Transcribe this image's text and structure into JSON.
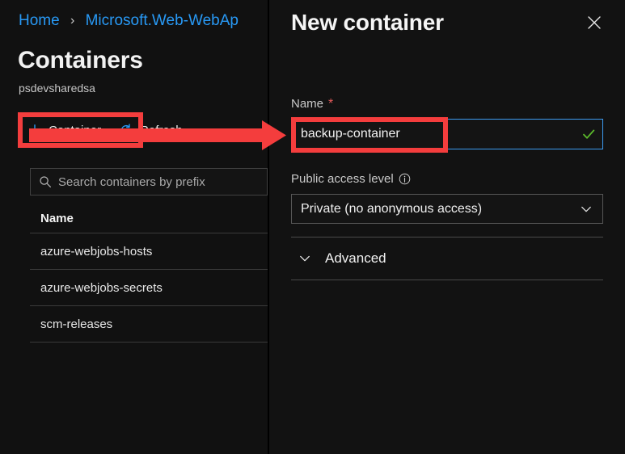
{
  "left_panel": {
    "breadcrumb": {
      "items": [
        {
          "label": "Home"
        },
        {
          "label": "Microsoft.Web-WebAp"
        }
      ],
      "separator": "›"
    },
    "page_title": "Containers",
    "page_subtitle": "psdevsharedsa",
    "toolbar": {
      "add_container_label": "Container",
      "add_container_icon": "plus-icon",
      "refresh_label": "Refresh",
      "refresh_icon": "refresh-icon"
    },
    "search": {
      "placeholder": "Search containers by prefix",
      "value": "",
      "icon": "search-icon"
    },
    "table": {
      "columns": [
        "Name"
      ],
      "rows": [
        {
          "name": "azure-webjobs-hosts"
        },
        {
          "name": "azure-webjobs-secrets"
        },
        {
          "name": "scm-releases"
        }
      ]
    }
  },
  "right_panel": {
    "title": "New container",
    "close_icon": "close-icon",
    "name_field": {
      "label": "Name",
      "required_marker": "*",
      "value": "backup-container",
      "valid_icon": "checkmark-icon"
    },
    "public_access": {
      "label": "Public access level",
      "info_icon": "info-icon",
      "selected": "Private (no anonymous access)",
      "chevron_icon": "chevron-down-icon"
    },
    "advanced": {
      "label": "Advanced",
      "chevron_icon": "chevron-down-icon",
      "expanded": false
    }
  },
  "annotations": {
    "highlight_container_button": "red-rectangle-highlight",
    "highlight_name_input": "red-rectangle-highlight",
    "arrow": "red-arrow-pointing-right"
  },
  "colors": {
    "background": "#0f0f0f",
    "panel": "#121212",
    "accent_link": "#2899f5",
    "annotation_red": "#f43d3d",
    "valid_green": "#5bb82b",
    "required_red": "#e85c5c",
    "focus_border": "#3c9bf0"
  }
}
